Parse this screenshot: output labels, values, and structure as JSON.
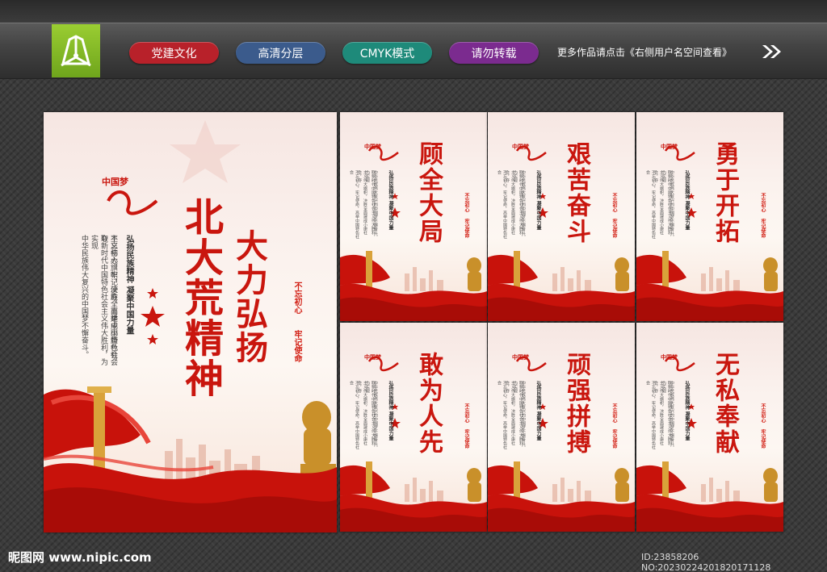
{
  "header": {
    "tags": [
      {
        "label": "党建文化",
        "color": "#b8212a"
      },
      {
        "label": "高清分层",
        "color": "#3b5b8c"
      },
      {
        "label": "CMYK模式",
        "color": "#1e8a7a"
      },
      {
        "label": "请勿转载",
        "color": "#7b2b8f"
      }
    ],
    "more_text": "更多作品请点击《右侧用户名空间查看》",
    "logo_icon": "pen-nib-icon"
  },
  "main_poster": {
    "title": "北大荒精神",
    "subtitle": "大力弘扬",
    "logo_text": "中国梦",
    "slogan": "弘扬民族精神 凝聚中国力量",
    "seal_1": "不忘初心",
    "seal_2": "牢记使命",
    "body_lines": [
      "不忘初心，牢记使命，高举中国特色社会",
      "主义伟大旗帜，决胜全面建成小康社会，夺",
      "取新时代中国特色社会主义伟大胜利，为实现",
      "中华民族伟大复兴的中国梦不懈奋斗。"
    ]
  },
  "small_posters": [
    {
      "title": "顾全大局"
    },
    {
      "title": "艰苦奋斗"
    },
    {
      "title": "勇于开拓"
    },
    {
      "title": "敢为人先"
    },
    {
      "title": "顽强拼搏"
    },
    {
      "title": "无私奉献"
    }
  ],
  "small_common": {
    "logo_text": "中国梦",
    "slogan": "弘扬民族精神 凝聚中国力量",
    "seal_1": "不忘初心",
    "seal_2": "牢记使命"
  },
  "footer": {
    "site": "昵图网 www.nipic.com",
    "id_text": "ID:23858206 NO:20230224201820171128"
  },
  "colors": {
    "brand_red": "#c9160e",
    "logo_green": "#8bc220"
  }
}
